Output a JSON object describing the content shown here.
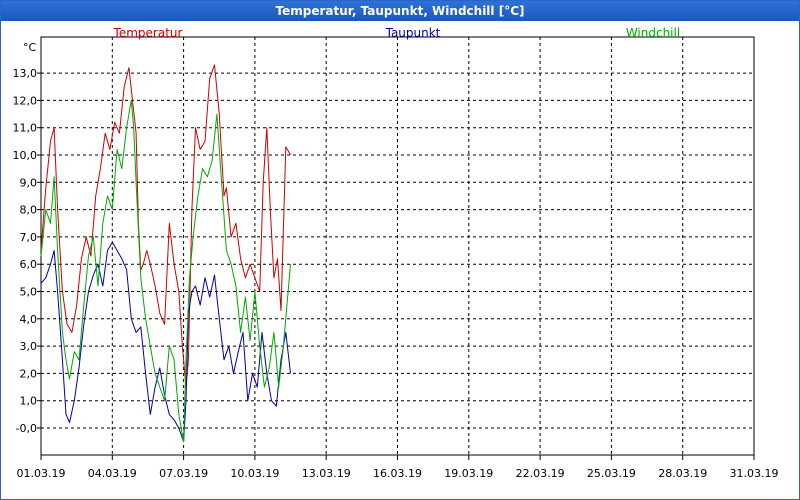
{
  "window": {
    "title": "Temperatur, Taupunkt, Windchill [°C]"
  },
  "chart_data": {
    "type": "line",
    "title": "Temperatur, Taupunkt, Windchill [°C]",
    "ylabel": "°C",
    "xlabel": "",
    "ylim": [
      -1.0,
      14.0
    ],
    "y_ticks": [
      -0.0,
      1.0,
      2.0,
      3.0,
      4.0,
      5.0,
      6.0,
      7.0,
      8.0,
      9.0,
      10.0,
      11.0,
      12.0,
      13.0
    ],
    "y_tick_labels": [
      "-0,0",
      "1,0",
      "2,0",
      "3,0",
      "4,0",
      "5,0",
      "6,0",
      "7,0",
      "8,0",
      "9,0",
      "10,0",
      "11,0",
      "12,0",
      "13,0"
    ],
    "xlim_days": [
      0,
      30
    ],
    "x_ticks_days": [
      0,
      3,
      6,
      9,
      12,
      15,
      18,
      21,
      24,
      27,
      30
    ],
    "x_tick_labels": [
      "01.03.19",
      "04.03.19",
      "07.03.19",
      "10.03.19",
      "13.03.19",
      "16.03.19",
      "19.03.19",
      "22.03.19",
      "25.03.19",
      "28.03.19",
      "31.03.19"
    ],
    "grid": true,
    "legend_position": "top",
    "series": [
      {
        "name": "Temperatur",
        "color": "#cc0000",
        "x": [
          0.0,
          0.2,
          0.4,
          0.55,
          0.7,
          0.9,
          1.1,
          1.3,
          1.5,
          1.7,
          1.9,
          2.1,
          2.3,
          2.5,
          2.7,
          2.9,
          3.1,
          3.3,
          3.5,
          3.7,
          3.85,
          4.0,
          4.1,
          4.2,
          4.3,
          4.45,
          4.6,
          4.8,
          5.0,
          5.2,
          5.4,
          5.6,
          5.8,
          5.95,
          6.1,
          6.2,
          6.35,
          6.5,
          6.7,
          6.9,
          7.1,
          7.3,
          7.5,
          7.6,
          7.7,
          7.8,
          8.0,
          8.2,
          8.4,
          8.6,
          8.8,
          9.0,
          9.2,
          9.35,
          9.5,
          9.65,
          9.8,
          9.95,
          10.1,
          10.3,
          10.5
        ],
        "values": [
          6.5,
          8.8,
          10.5,
          11.0,
          8.0,
          5.0,
          3.8,
          3.5,
          4.5,
          6.2,
          7.0,
          6.3,
          8.5,
          9.5,
          10.8,
          10.2,
          11.2,
          10.8,
          12.5,
          13.2,
          12.0,
          10.8,
          7.5,
          5.8,
          6.0,
          6.5,
          6.0,
          5.2,
          4.2,
          3.8,
          7.5,
          6.0,
          5.0,
          3.0,
          1.5,
          2.5,
          8.0,
          11.0,
          10.2,
          10.5,
          12.8,
          13.3,
          11.5,
          10.0,
          8.5,
          8.8,
          7.0,
          7.5,
          6.2,
          5.5,
          6.0,
          5.5,
          5.0,
          9.0,
          11.0,
          8.0,
          5.5,
          6.2,
          4.3,
          10.3,
          10.0
        ]
      },
      {
        "name": "Taupunkt",
        "color": "#0000aa",
        "x": [
          0.0,
          0.2,
          0.4,
          0.55,
          0.7,
          0.9,
          1.05,
          1.2,
          1.4,
          1.6,
          1.8,
          2.0,
          2.2,
          2.4,
          2.6,
          2.8,
          3.0,
          3.2,
          3.4,
          3.6,
          3.8,
          4.0,
          4.2,
          4.4,
          4.6,
          4.8,
          5.0,
          5.2,
          5.4,
          5.6,
          5.8,
          6.0,
          6.1,
          6.2,
          6.35,
          6.5,
          6.7,
          6.9,
          7.1,
          7.3,
          7.5,
          7.7,
          7.9,
          8.1,
          8.3,
          8.5,
          8.7,
          8.9,
          9.1,
          9.3,
          9.5,
          9.7,
          9.9,
          10.1,
          10.3,
          10.5
        ],
        "values": [
          5.3,
          5.5,
          6.0,
          6.5,
          5.0,
          2.5,
          0.5,
          0.2,
          1.0,
          2.2,
          3.8,
          5.0,
          5.6,
          6.0,
          5.2,
          6.5,
          6.8,
          6.5,
          6.2,
          5.8,
          4.0,
          3.5,
          3.7,
          2.0,
          0.5,
          1.5,
          2.2,
          1.2,
          0.5,
          0.3,
          0.0,
          -0.5,
          1.0,
          4.2,
          5.0,
          5.2,
          4.5,
          5.5,
          4.8,
          5.6,
          4.0,
          2.5,
          3.0,
          2.0,
          2.8,
          3.5,
          1.0,
          2.0,
          1.5,
          3.5,
          2.0,
          1.0,
          0.8,
          2.5,
          3.5,
          2.0
        ]
      },
      {
        "name": "Windchill",
        "color": "#00aa00",
        "x": [
          0.0,
          0.2,
          0.4,
          0.55,
          0.7,
          0.9,
          1.05,
          1.2,
          1.4,
          1.6,
          1.8,
          2.0,
          2.2,
          2.4,
          2.6,
          2.8,
          3.0,
          3.2,
          3.4,
          3.6,
          3.8,
          3.9,
          4.0,
          4.2,
          4.4,
          4.6,
          4.8,
          5.0,
          5.2,
          5.4,
          5.6,
          5.8,
          6.0,
          6.1,
          6.25,
          6.4,
          6.6,
          6.8,
          7.0,
          7.2,
          7.4,
          7.6,
          7.8,
          8.0,
          8.2,
          8.4,
          8.6,
          8.8,
          9.0,
          9.2,
          9.4,
          9.6,
          9.8,
          10.0,
          10.2,
          10.5
        ],
        "values": [
          6.3,
          8.0,
          7.5,
          9.2,
          6.5,
          3.5,
          2.5,
          1.8,
          2.8,
          2.5,
          4.5,
          6.3,
          7.0,
          5.2,
          7.5,
          8.5,
          8.0,
          10.2,
          9.5,
          11.0,
          12.0,
          11.0,
          9.0,
          5.5,
          4.0,
          3.0,
          2.0,
          1.5,
          1.0,
          3.0,
          2.5,
          0.5,
          -0.5,
          2.5,
          5.5,
          7.0,
          8.5,
          9.5,
          9.2,
          9.8,
          11.5,
          9.0,
          6.5,
          6.0,
          5.2,
          3.5,
          4.8,
          3.2,
          5.0,
          3.0,
          1.5,
          2.2,
          3.5,
          1.5,
          3.0,
          6.0
        ]
      }
    ]
  }
}
